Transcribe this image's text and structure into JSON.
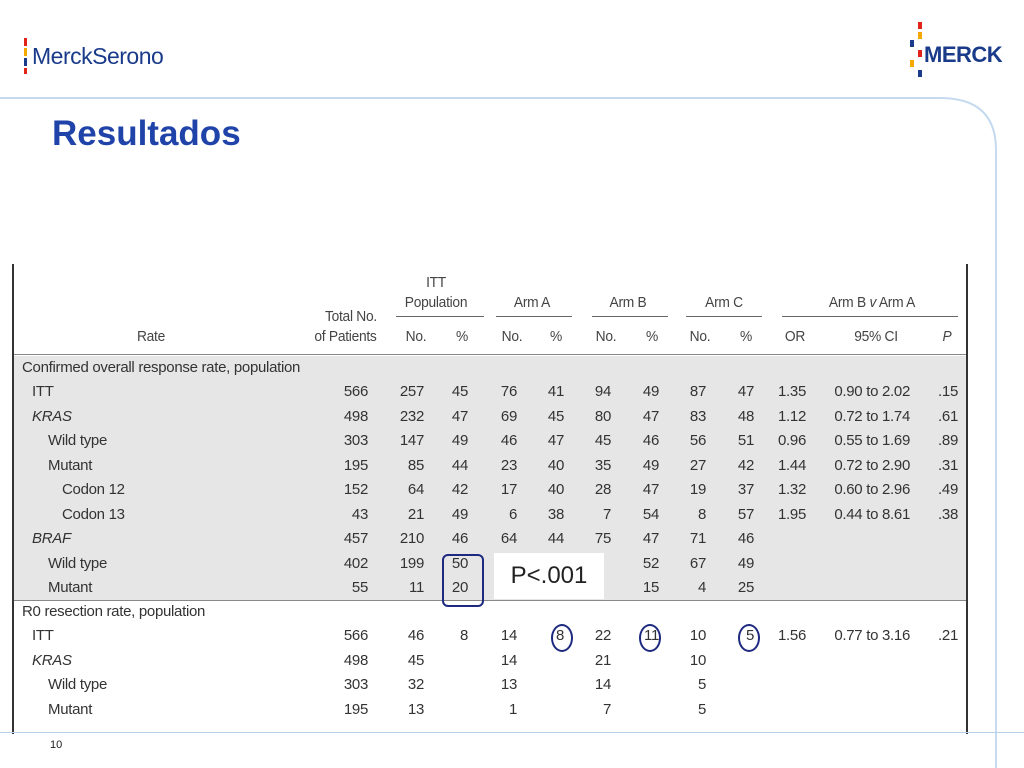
{
  "header": {
    "logo_left_text": "MerckSerono",
    "logo_right_text": "MERCK",
    "title": "Resultados"
  },
  "table": {
    "headers": {
      "rate": "Rate",
      "total_line1": "Total No.",
      "total_line2": "of Patients",
      "itt_line1": "ITT",
      "itt_line2": "Population",
      "arm_a": "Arm A",
      "arm_b": "Arm B",
      "arm_c": "Arm C",
      "arm_bva_prefix": "Arm B ",
      "arm_bva_v": "v",
      "arm_bva_suffix": " Arm A",
      "no": "No.",
      "pct": "%",
      "or": "OR",
      "ci": "95% CI",
      "p": "P"
    },
    "sections": [
      {
        "label": "Confirmed overall response rate, population",
        "rows": [
          {
            "label": "ITT",
            "indent": 0,
            "italic": false,
            "total": "566",
            "itt_no": "257",
            "itt_pct": "45",
            "a_no": "76",
            "a_pct": "41",
            "b_no": "94",
            "b_pct": "49",
            "c_no": "87",
            "c_pct": "47",
            "or": "1.35",
            "ci": "0.90 to 2.02",
            "p": ".15"
          },
          {
            "label": "KRAS",
            "indent": 0,
            "italic": true,
            "total": "498",
            "itt_no": "232",
            "itt_pct": "47",
            "a_no": "69",
            "a_pct": "45",
            "b_no": "80",
            "b_pct": "47",
            "c_no": "83",
            "c_pct": "48",
            "or": "1.12",
            "ci": "0.72 to 1.74",
            "p": ".61"
          },
          {
            "label": "Wild type",
            "indent": 1,
            "italic": false,
            "total": "303",
            "itt_no": "147",
            "itt_pct": "49",
            "a_no": "46",
            "a_pct": "47",
            "b_no": "45",
            "b_pct": "46",
            "c_no": "56",
            "c_pct": "51",
            "or": "0.96",
            "ci": "0.55 to 1.69",
            "p": ".89"
          },
          {
            "label": "Mutant",
            "indent": 1,
            "italic": false,
            "total": "195",
            "itt_no": "85",
            "itt_pct": "44",
            "a_no": "23",
            "a_pct": "40",
            "b_no": "35",
            "b_pct": "49",
            "c_no": "27",
            "c_pct": "42",
            "or": "1.44",
            "ci": "0.72 to 2.90",
            "p": ".31"
          },
          {
            "label": "Codon 12",
            "indent": 2,
            "italic": false,
            "total": "152",
            "itt_no": "64",
            "itt_pct": "42",
            "a_no": "17",
            "a_pct": "40",
            "b_no": "28",
            "b_pct": "47",
            "c_no": "19",
            "c_pct": "37",
            "or": "1.32",
            "ci": "0.60 to 2.96",
            "p": ".49"
          },
          {
            "label": "Codon 13",
            "indent": 2,
            "italic": false,
            "total": "43",
            "itt_no": "21",
            "itt_pct": "49",
            "a_no": "6",
            "a_pct": "38",
            "b_no": "7",
            "b_pct": "54",
            "c_no": "8",
            "c_pct": "57",
            "or": "1.95",
            "ci": "0.44 to 8.61",
            "p": ".38"
          },
          {
            "label": "BRAF",
            "indent": 0,
            "italic": true,
            "total": "457",
            "itt_no": "210",
            "itt_pct": "46",
            "a_no": "64",
            "a_pct": "44",
            "b_no": "75",
            "b_pct": "47",
            "c_no": "71",
            "c_pct": "46",
            "or": "",
            "ci": "",
            "p": ""
          },
          {
            "label": "Wild type",
            "indent": 1,
            "italic": false,
            "total": "402",
            "itt_no": "199",
            "itt_pct": "50",
            "a_no": "",
            "a_pct": "",
            "b_no": "",
            "b_pct": "52",
            "c_no": "67",
            "c_pct": "49",
            "or": "",
            "ci": "",
            "p": ""
          },
          {
            "label": "Mutant",
            "indent": 1,
            "italic": false,
            "total": "55",
            "itt_no": "11",
            "itt_pct": "20",
            "a_no": "",
            "a_pct": "",
            "b_no": "",
            "b_pct": "15",
            "c_no": "4",
            "c_pct": "25",
            "or": "",
            "ci": "",
            "p": ""
          }
        ]
      },
      {
        "label": "R0 resection rate, population",
        "rows": [
          {
            "label": "ITT",
            "indent": 0,
            "italic": false,
            "total": "566",
            "itt_no": "46",
            "itt_pct": "8",
            "a_no": "14",
            "a_pct": "8",
            "b_no": "22",
            "b_pct": "11",
            "c_no": "10",
            "c_pct": "5",
            "or": "1.56",
            "ci": "0.77 to 3.16",
            "p": ".21"
          },
          {
            "label": "KRAS",
            "indent": 0,
            "italic": true,
            "total": "498",
            "itt_no": "45",
            "itt_pct": "",
            "a_no": "14",
            "a_pct": "",
            "b_no": "21",
            "b_pct": "",
            "c_no": "10",
            "c_pct": "",
            "or": "",
            "ci": "",
            "p": ""
          },
          {
            "label": "Wild type",
            "indent": 1,
            "italic": false,
            "total": "303",
            "itt_no": "32",
            "itt_pct": "",
            "a_no": "13",
            "a_pct": "",
            "b_no": "14",
            "b_pct": "",
            "c_no": "5",
            "c_pct": "",
            "or": "",
            "ci": "",
            "p": ""
          },
          {
            "label": "Mutant",
            "indent": 1,
            "italic": false,
            "total": "195",
            "itt_no": "13",
            "itt_pct": "",
            "a_no": "1",
            "a_pct": "",
            "b_no": "7",
            "b_pct": "",
            "c_no": "5",
            "c_pct": "",
            "or": "",
            "ci": "",
            "p": ""
          }
        ]
      }
    ]
  },
  "annotations": {
    "callout_text": "P<.001"
  },
  "footer": {
    "page_number": "10"
  },
  "colors": {
    "title": "#1f43a8",
    "logo": "#1a3a8a",
    "band": "#e6e6e6",
    "annotation": "#1e2a80"
  }
}
